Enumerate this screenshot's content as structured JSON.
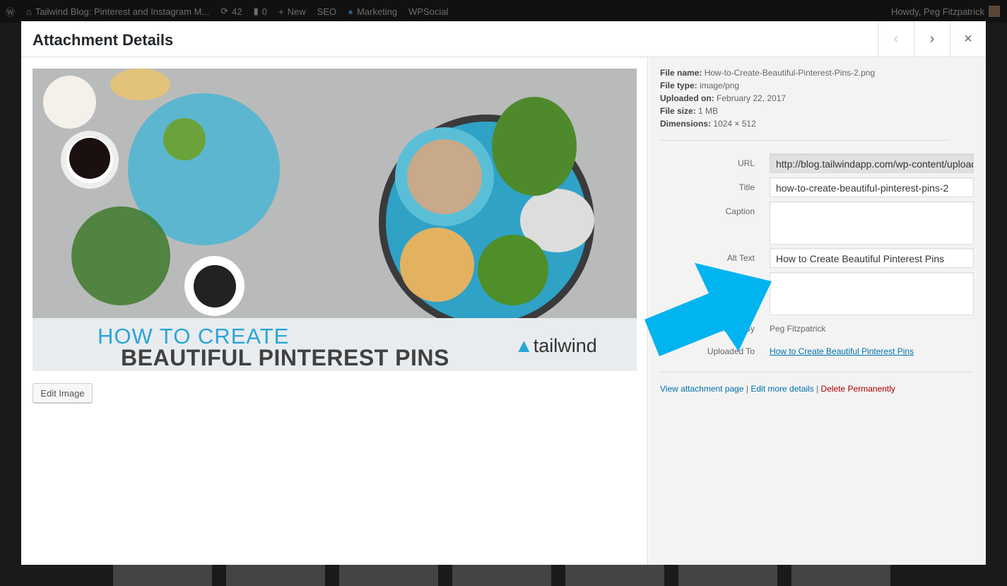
{
  "admin_bar": {
    "site_title": "Tailwind Blog: Pinterest and Instagram M...",
    "updates": "42",
    "comments": "0",
    "new_label": "New",
    "seo": "SEO",
    "marketing": "Marketing",
    "wpsocial": "WPSocial",
    "howdy": "Howdy, Peg Fitzpatrick"
  },
  "modal": {
    "title": "Attachment Details",
    "prev": "‹",
    "next": "›",
    "close": "×"
  },
  "image": {
    "line1": "HOW TO CREATE",
    "line2": "BEAUTIFUL PINTEREST PINS",
    "logo": "tailwind"
  },
  "edit_image": "Edit Image",
  "meta": {
    "file_name_label": "File name:",
    "file_name": "How-to-Create-Beautiful-Pinterest-Pins-2.png",
    "file_type_label": "File type:",
    "file_type": "image/png",
    "uploaded_on_label": "Uploaded on:",
    "uploaded_on": "February 22, 2017",
    "file_size_label": "File size:",
    "file_size": "1 MB",
    "dimensions_label": "Dimensions:",
    "dimensions": "1024 × 512"
  },
  "fields": {
    "url_label": "URL",
    "url": "http://blog.tailwindapp.com/wp-content/uploads/",
    "title_label": "Title",
    "title": "how-to-create-beautiful-pinterest-pins-2",
    "caption_label": "Caption",
    "caption": "",
    "alt_label": "Alt Text",
    "alt": "How to Create Beautiful Pinterest Pins",
    "description": "",
    "uploaded_by_label": "Uploaded By",
    "uploaded_by": "Peg Fitzpatrick",
    "uploaded_to_label": "Uploaded To",
    "uploaded_to": "How to Create Beautiful Pinterest Pins"
  },
  "actions": {
    "view": "View attachment page",
    "edit": "Edit more details",
    "delete": "Delete Permanently",
    "sep": "|"
  },
  "colors": {
    "arrow": "#00b4f0",
    "link": "#0073aa",
    "delete": "#a00"
  }
}
